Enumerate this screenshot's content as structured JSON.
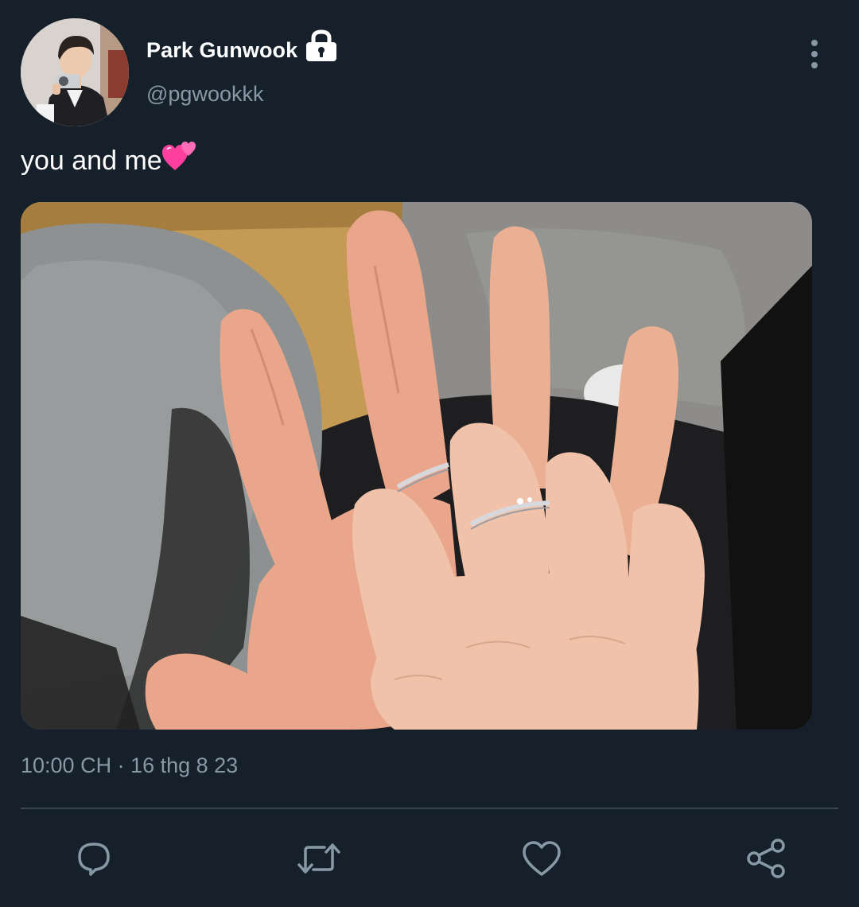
{
  "author": {
    "display_name": "Park Gunwook",
    "handle": "@pgwookkk",
    "protected_icon": "lock-icon",
    "avatar_icon": "profile-photo"
  },
  "tweet": {
    "text": "you and me",
    "emoji_icon": "two-hearts-emoji",
    "media_alt": "photo of two hands making peace signs wearing matching rings",
    "timestamp": "10:00 CH · 16 thg 8 23"
  },
  "actions": [
    {
      "icon": "reply-icon"
    },
    {
      "icon": "retweet-icon"
    },
    {
      "icon": "like-icon"
    },
    {
      "icon": "share-icon"
    }
  ],
  "colors": {
    "background": "#15202b",
    "text_primary": "#ffffff",
    "text_secondary": "#8899a6",
    "divider": "#38444d",
    "heart_emoji": "#ff4fa3"
  }
}
